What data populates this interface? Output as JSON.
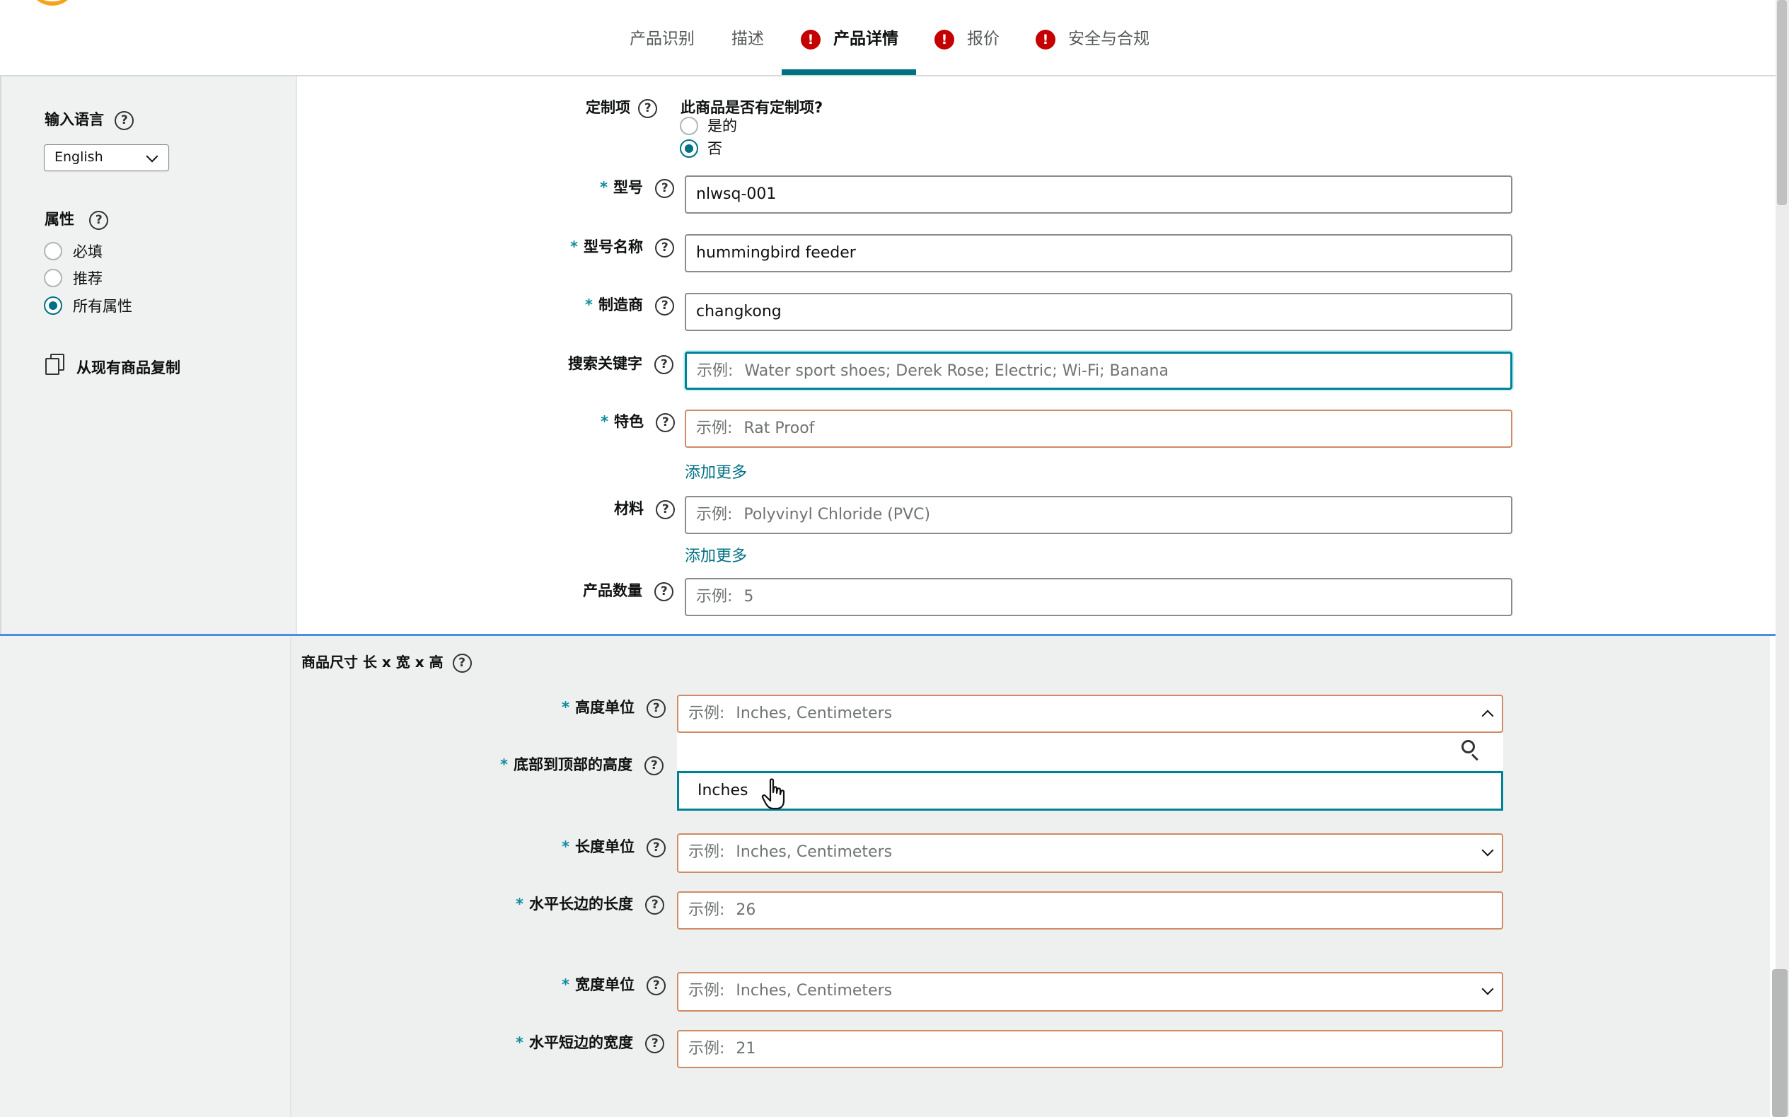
{
  "tabs": [
    {
      "label": "产品识别",
      "error": false,
      "active": false
    },
    {
      "label": "描述",
      "error": false,
      "active": false
    },
    {
      "label": "产品详情",
      "error": true,
      "active": true
    },
    {
      "label": "报价",
      "error": true,
      "active": false
    },
    {
      "label": "安全与合规",
      "error": true,
      "active": false
    }
  ],
  "sidebar": {
    "language_label": "输入语言",
    "language_value": "English",
    "attributes_label": "属性",
    "attribute_options": [
      {
        "label": "必填",
        "checked": false
      },
      {
        "label": "推荐",
        "checked": false
      },
      {
        "label": "所有属性",
        "checked": true
      }
    ],
    "copy_label": "从现有商品复制"
  },
  "form": {
    "customization": {
      "label": "定制项",
      "question": "此商品是否有定制项?",
      "options": [
        {
          "label": "是的",
          "checked": false
        },
        {
          "label": "否",
          "checked": true
        }
      ]
    },
    "model_number": {
      "label": "型号",
      "required": true,
      "value": "nlwsq-001"
    },
    "model_name": {
      "label": "型号名称",
      "required": true,
      "value": "hummingbird feeder"
    },
    "manufacturer": {
      "label": "制造商",
      "required": true,
      "value": "changkong"
    },
    "search_terms": {
      "label": "搜索关键字",
      "required": false,
      "prefix": "示例:",
      "placeholder": "Water sport shoes; Derek Rose; Electric; Wi-Fi; Banana"
    },
    "special_feature": {
      "label": "特色",
      "required": true,
      "prefix": "示例:",
      "placeholder": "Rat Proof",
      "add_more": "添加更多"
    },
    "material": {
      "label": "材料",
      "required": false,
      "prefix": "示例:",
      "placeholder": "Polyvinyl Chloride (PVC)",
      "add_more": "添加更多"
    },
    "item_quantity": {
      "label": "产品数量",
      "required": false,
      "prefix": "示例:",
      "placeholder": "5"
    }
  },
  "dimensions": {
    "section_label": "商品尺寸 长 x 宽 x 高",
    "height_unit": {
      "label": "高度单位",
      "required": true,
      "prefix": "示例:",
      "placeholder": "Inches, Centimeters",
      "option": "Inches"
    },
    "height": {
      "label": "底部到顶部的高度",
      "required": true
    },
    "length_unit": {
      "label": "长度单位",
      "required": true,
      "prefix": "示例:",
      "placeholder": "Inches, Centimeters"
    },
    "length": {
      "label": "水平长边的长度",
      "required": true,
      "prefix": "示例:",
      "placeholder": "26"
    },
    "width_unit": {
      "label": "宽度单位",
      "required": true,
      "prefix": "示例:",
      "placeholder": "Inches, Centimeters"
    },
    "width": {
      "label": "水平短边的宽度",
      "required": true,
      "prefix": "示例:",
      "placeholder": "21"
    }
  },
  "colors": {
    "accent": "#007185",
    "error": "#c40000",
    "warn_border": "#d08a64",
    "focus": "#008296"
  },
  "icons": {
    "help": "help-circle-icon",
    "error": "exclamation-circle-icon",
    "copy": "copy-icon",
    "search": "search-icon",
    "chevron": "chevron-down-icon",
    "cursor": "hand-pointer-icon"
  }
}
